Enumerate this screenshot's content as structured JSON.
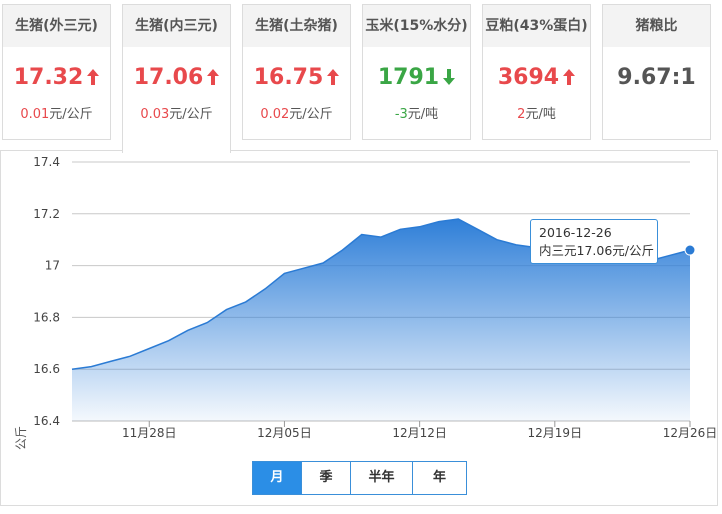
{
  "cards": [
    {
      "title": "生猪(外三元)",
      "value": "17.32",
      "direction": "up",
      "change": "0.01",
      "unit": "元/公斤"
    },
    {
      "title": "生猪(内三元)",
      "value": "17.06",
      "direction": "up",
      "change": "0.03",
      "unit": "元/公斤",
      "active": true
    },
    {
      "title": "生猪(土杂猪)",
      "value": "16.75",
      "direction": "up",
      "change": "0.02",
      "unit": "元/公斤"
    },
    {
      "title": "玉米(15%水分)",
      "value": "1791",
      "direction": "down",
      "change": "-3",
      "unit": "元/吨"
    },
    {
      "title": "豆粕(43%蛋白)",
      "value": "3694",
      "direction": "up",
      "change": "2",
      "unit": "元/吨"
    },
    {
      "title": "猪粮比",
      "value": "9.67:1",
      "direction": "none",
      "change": "",
      "unit": ""
    }
  ],
  "colors": {
    "up": "#e8494c",
    "down": "#3aa645",
    "accent": "#2b8ee6",
    "area_top": "#2f7fd8",
    "area_bottom": "#ffffff"
  },
  "tooltip": {
    "date": "2016-12-26",
    "text": "内三元17.06元/公斤"
  },
  "periods": [
    {
      "label": "月",
      "active": true
    },
    {
      "label": "季",
      "active": false
    },
    {
      "label": "半年",
      "active": false
    },
    {
      "label": "年",
      "active": false
    }
  ],
  "chart_data": {
    "type": "area",
    "ylabel": "元/公斤",
    "ylim": [
      16.4,
      17.4
    ],
    "yticks": [
      "17.4",
      "17.2",
      "17",
      "16.8",
      "16.6",
      "16.4"
    ],
    "xlim": [
      "2016-11-24",
      "2016-12-26"
    ],
    "xticks": [
      {
        "label": "11月28日",
        "date": "2016-11-28"
      },
      {
        "label": "12月05日",
        "date": "2016-12-05"
      },
      {
        "label": "12月12日",
        "date": "2016-12-12"
      },
      {
        "label": "12月19日",
        "date": "2016-12-19"
      },
      {
        "label": "12月26日",
        "date": "2016-12-26"
      }
    ],
    "grid": true,
    "series": [
      {
        "name": "内三元",
        "x": [
          "2016-11-24",
          "2016-11-25",
          "2016-11-26",
          "2016-11-27",
          "2016-11-28",
          "2016-11-29",
          "2016-11-30",
          "2016-12-01",
          "2016-12-02",
          "2016-12-03",
          "2016-12-04",
          "2016-12-05",
          "2016-12-06",
          "2016-12-07",
          "2016-12-08",
          "2016-12-09",
          "2016-12-10",
          "2016-12-11",
          "2016-12-12",
          "2016-12-13",
          "2016-12-14",
          "2016-12-15",
          "2016-12-16",
          "2016-12-17",
          "2016-12-18",
          "2016-12-19",
          "2016-12-20",
          "2016-12-21",
          "2016-12-22",
          "2016-12-23",
          "2016-12-24",
          "2016-12-25",
          "2016-12-26"
        ],
        "values": [
          16.6,
          16.61,
          16.63,
          16.65,
          16.68,
          16.71,
          16.75,
          16.78,
          16.83,
          16.86,
          16.91,
          16.97,
          16.99,
          17.01,
          17.06,
          17.12,
          17.11,
          17.14,
          17.15,
          17.17,
          17.18,
          17.14,
          17.1,
          17.08,
          17.07,
          17.06,
          17.05,
          17.05,
          17.04,
          17.03,
          17.02,
          17.04,
          17.06
        ]
      }
    ]
  }
}
